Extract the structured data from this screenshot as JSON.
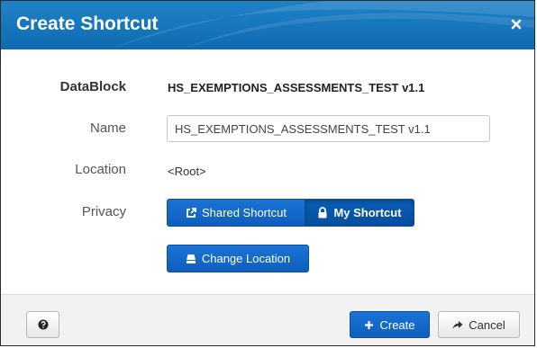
{
  "dialog": {
    "title": "Create Shortcut",
    "close_icon": "close-icon"
  },
  "form": {
    "datablock": {
      "label": "DataBlock",
      "value": "HS_EXEMPTIONS_ASSESSMENTS_TEST v1.1"
    },
    "name": {
      "label": "Name",
      "value": "HS_EXEMPTIONS_ASSESSMENTS_TEST v1.1"
    },
    "location": {
      "label": "Location",
      "value": "<Root>"
    },
    "privacy": {
      "label": "Privacy",
      "options": [
        {
          "label": "Shared Shortcut",
          "icon": "external-link-icon",
          "selected": false
        },
        {
          "label": "My Shortcut",
          "icon": "lock-icon",
          "selected": true
        }
      ]
    },
    "change_location": {
      "label": "Change Location",
      "icon": "drive-icon"
    }
  },
  "footer": {
    "help_icon": "question-icon",
    "create_label": "Create",
    "create_icon": "plus-icon",
    "cancel_label": "Cancel",
    "cancel_icon": "share-arrow-icon"
  },
  "colors": {
    "title_bar": "#1478c2",
    "primary_button": "#1266c8",
    "primary_button_active": "#0a569f",
    "footer_bg": "#f2f2f2"
  }
}
